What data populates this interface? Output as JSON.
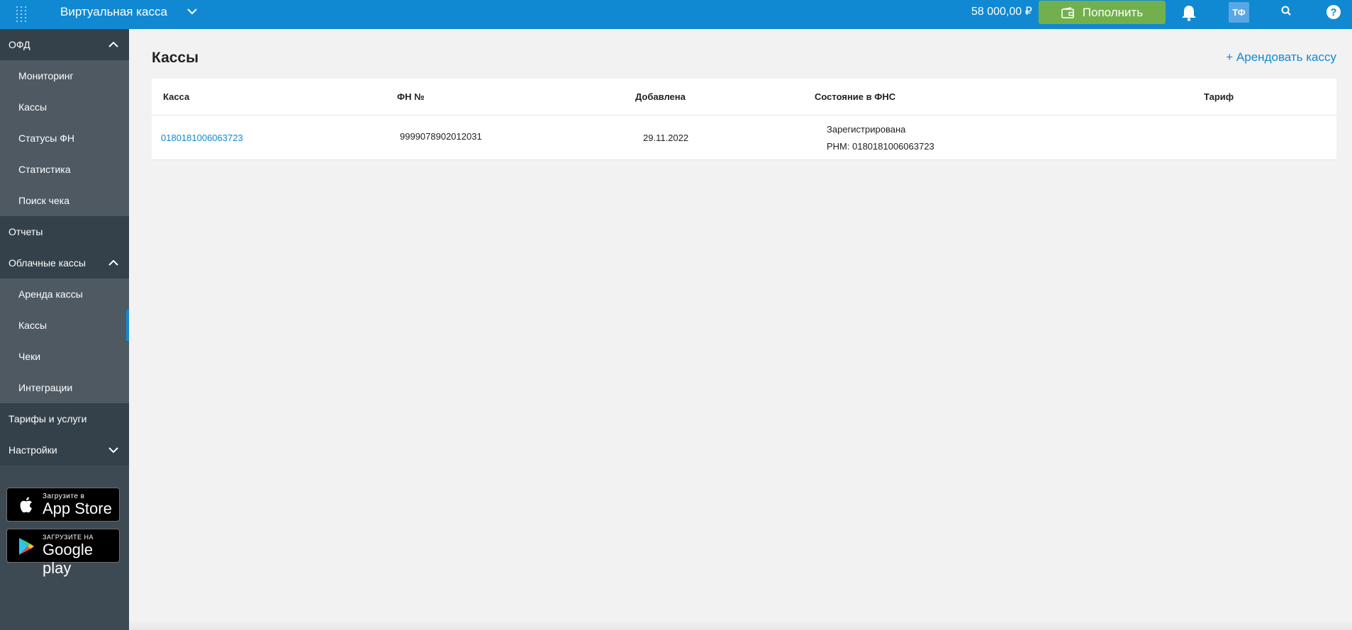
{
  "header": {
    "app_title": "Виртуальная касса",
    "balance": "58 000,00 ₽",
    "topup_label": "Пополнить",
    "avatar_initials": "ТФ",
    "help_label": "?"
  },
  "sidebar": {
    "groups": [
      {
        "label": "ОФД",
        "items": [
          "Мониторинг",
          "Кассы",
          "Статусы ФН",
          "Статистика",
          "Поиск чека"
        ]
      },
      {
        "label": "Отчеты"
      },
      {
        "label": "Облачные кассы",
        "items": [
          "Аренда кассы",
          "Кассы",
          "Чеки",
          "Интеграции"
        ]
      },
      {
        "label": "Тарифы и услуги"
      },
      {
        "label": "Настройки"
      }
    ],
    "active_item": "Кассы",
    "app_store": {
      "small": "Загрузите в",
      "big": "App Store"
    },
    "google_play": {
      "small": "ЗАГРУЗИТЕ НА",
      "big": "Google play"
    }
  },
  "main": {
    "title": "Кассы",
    "rent_link": "+ Арендовать кассу",
    "columns": [
      "Касса",
      "ФН №",
      "Добавлена",
      "Состояние в ФНС",
      "Тариф"
    ],
    "rows": [
      {
        "kassa": "0180181006063723",
        "fn": "9999078902012031",
        "added": "29.11.2022",
        "status_line1": "Зарегистрирована",
        "status_line2": "РНМ: 0180181006063723",
        "tariff": ""
      }
    ]
  },
  "colors": {
    "header_bg": "#1189d2",
    "sidebar_bg": "#3e4a53",
    "topup_bg": "#72b04e",
    "link": "#1189d2"
  }
}
